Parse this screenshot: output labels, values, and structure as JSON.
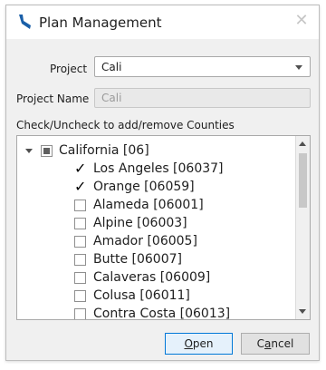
{
  "window": {
    "title": "Plan Management",
    "close_symbol": "✕"
  },
  "form": {
    "project_label": "Project",
    "project_value": "Cali",
    "project_name_label": "Project Name",
    "project_name_value": "Cali",
    "instructions": "Check/Uncheck to add/remove Counties"
  },
  "tree": {
    "root": {
      "label": "California [06]",
      "state": "partial"
    },
    "items": [
      {
        "label": "Los Angeles [06037]",
        "checked": true
      },
      {
        "label": "Orange [06059]",
        "checked": true
      },
      {
        "label": "Alameda [06001]",
        "checked": false
      },
      {
        "label": "Alpine [06003]",
        "checked": false
      },
      {
        "label": "Amador [06005]",
        "checked": false
      },
      {
        "label": "Butte [06007]",
        "checked": false
      },
      {
        "label": "Calaveras [06009]",
        "checked": false
      },
      {
        "label": "Colusa [06011]",
        "checked": false
      },
      {
        "label": "Contra Costa [06013]",
        "checked": false
      }
    ]
  },
  "buttons": {
    "open_mnemonic": "O",
    "open_rest": "pen",
    "cancel_prefix": "C",
    "cancel_mnemonic": "a",
    "cancel_rest": "ncel"
  },
  "colors": {
    "accent": "#0078d7",
    "icon": "#1a5fa8"
  }
}
